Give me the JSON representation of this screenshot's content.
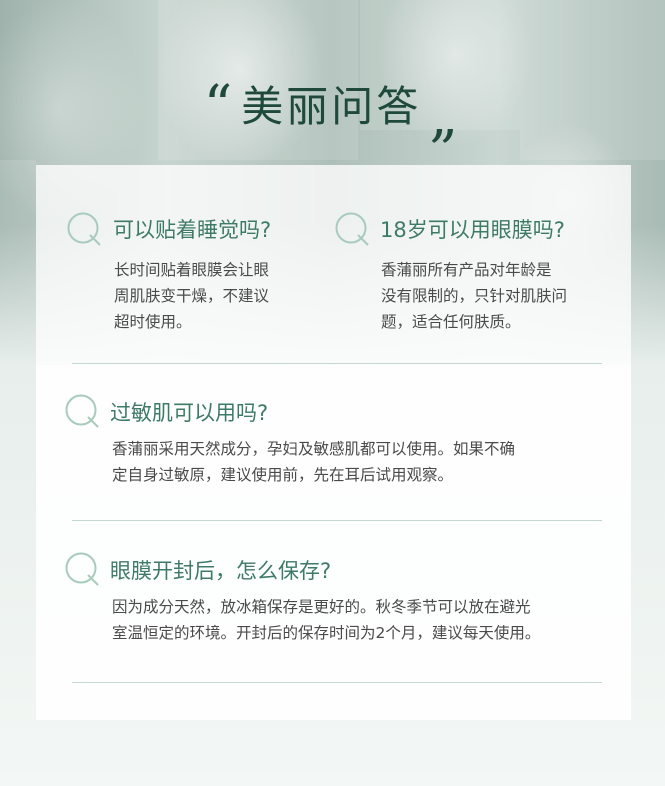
{
  "title": {
    "open_quote": "“",
    "text": "美丽问答",
    "close_quote": "„"
  },
  "qa": [
    {
      "question": "可以贴着睡觉吗?",
      "answer_lines": [
        "长时间贴着眼膜会让眼",
        "周肌肤变干燥，不建议",
        "超时使用。"
      ]
    },
    {
      "question": "18岁可以用眼膜吗?",
      "answer_lines": [
        "香蒲丽所有产品对年龄是",
        "没有限制的，只针对肌肤问",
        "题，适合任何肤质。"
      ]
    },
    {
      "question": "过敏肌可以用吗?",
      "answer_lines": [
        "香蒲丽采用天然成分，孕妇及敏感肌都可以使用。如果不确",
        "定自身过敏原，建议使用前，先在耳后试用观察。"
      ]
    },
    {
      "question": "眼膜开封后，怎么保存?",
      "answer_lines": [
        "因为成分天然，放冰箱保存是更好的。秋冬季节可以放在避光",
        "室温恒定的环境。开封后的保存时间为2个月，建议每天使用。"
      ]
    }
  ],
  "colors": {
    "title": "#1f4a3b",
    "question": "#3e7b66",
    "answer": "#4a4a4a",
    "q_icon": "#a8cbbd",
    "divider": "#c5d8d0"
  },
  "icons": [
    "q-letter-icon"
  ]
}
